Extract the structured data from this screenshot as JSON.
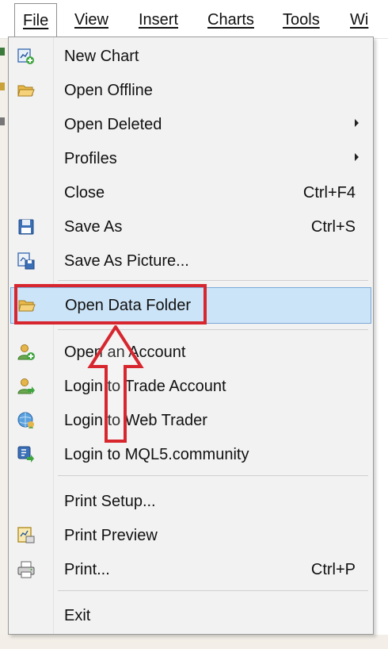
{
  "menubar": {
    "items": [
      {
        "label": "File",
        "active": true
      },
      {
        "label": "View"
      },
      {
        "label": "Insert"
      },
      {
        "label": "Charts"
      },
      {
        "label": "Tools"
      },
      {
        "label": "Wi"
      }
    ]
  },
  "file_menu": {
    "items": [
      {
        "label": "New Chart",
        "icon": "new-chart-icon"
      },
      {
        "label": "Open Offline",
        "icon": "open-folder-icon"
      },
      {
        "label": "Open Deleted",
        "has_submenu": true
      },
      {
        "label": "Profiles",
        "has_submenu": true
      },
      {
        "label": "Close",
        "shortcut": "Ctrl+F4"
      },
      {
        "label": "Save As",
        "shortcut": "Ctrl+S",
        "icon": "floppy-disk-icon"
      },
      {
        "label": "Save As Picture...",
        "icon": "save-picture-icon"
      },
      {
        "label": "Open Data Folder",
        "icon": "folder-icon",
        "highlighted": true
      },
      {
        "label": "Open an Account",
        "icon": "add-user-icon"
      },
      {
        "label": "Login to Trade Account",
        "icon": "user-login-icon"
      },
      {
        "label": "Login to Web Trader",
        "icon": "globe-user-icon"
      },
      {
        "label": "Login to MQL5.community",
        "icon": "mql5-login-icon"
      },
      {
        "label": "Print Setup..."
      },
      {
        "label": "Print Preview",
        "icon": "print-preview-icon"
      },
      {
        "label": "Print...",
        "shortcut": "Ctrl+P",
        "icon": "printer-icon"
      },
      {
        "label": "Exit"
      }
    ]
  },
  "colors": {
    "highlight_bg": "#cce4f7",
    "highlight_border": "#7aa9d8",
    "annotation_red": "#d7262e",
    "menu_bg": "#f2f2f2"
  }
}
